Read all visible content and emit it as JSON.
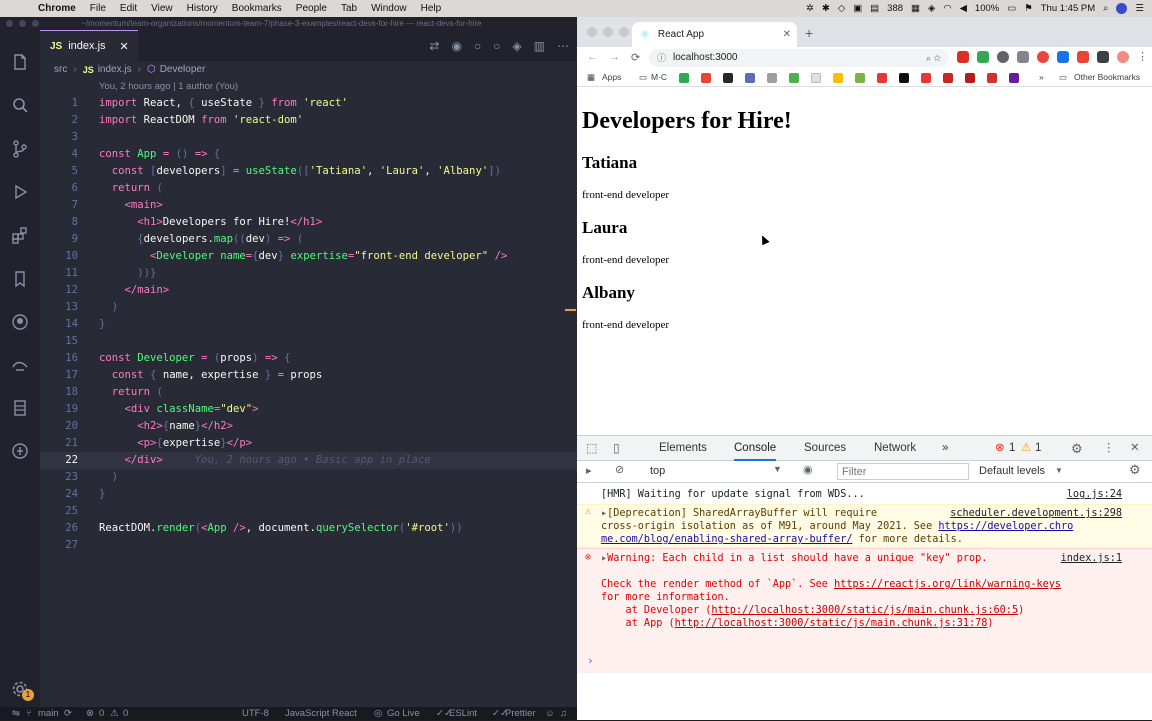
{
  "menubar": {
    "app": "Chrome",
    "items": [
      "File",
      "Edit",
      "View",
      "History",
      "Bookmarks",
      "People",
      "Tab",
      "Window",
      "Help"
    ],
    "notification_count": "388",
    "battery": "100%",
    "clock": "Thu 1:45 PM"
  },
  "vscode": {
    "title_path": "~/momentum/team-organizations/momentum-team-7/phase-3-examples/react-devs-for-hire — react-devs-for-hire",
    "tab": {
      "badge": "JS",
      "label": "index.js"
    },
    "breadcrumb": {
      "folder": "src",
      "badge": "JS",
      "file": "index.js",
      "symbol": "Developer"
    },
    "blame": "You, 2 hours ago | 1 author (You)",
    "ghost_blame": "You, 2 hours ago • Basic app in place",
    "line_numbers": [
      "1",
      "2",
      "3",
      "4",
      "5",
      "6",
      "7",
      "8",
      "9",
      "10",
      "11",
      "12",
      "13",
      "14",
      "15",
      "16",
      "17",
      "18",
      "19",
      "20",
      "21",
      "22",
      "23",
      "24",
      "25",
      "26",
      "27"
    ],
    "status": {
      "branch": "main",
      "errors": "0",
      "warnings": "0",
      "encoding": "UTF-8",
      "language": "JavaScript React",
      "golive": "Go Live",
      "eslint": "ESLint",
      "prettier": "Prettier"
    },
    "settings_badge": "1"
  },
  "chrome": {
    "tab_title": "React App",
    "url": "localhost:3000",
    "bookmarks": {
      "apps": "Apps",
      "mc": "M·C",
      "other": "Other Bookmarks"
    },
    "page": {
      "heading": "Developers for Hire!",
      "developers": [
        {
          "name": "Tatiana",
          "expertise": "front-end developer"
        },
        {
          "name": "Laura",
          "expertise": "front-end developer"
        },
        {
          "name": "Albany",
          "expertise": "front-end developer"
        }
      ]
    }
  },
  "devtools": {
    "tabs": [
      "Elements",
      "Console",
      "Sources",
      "Network"
    ],
    "active_tab": "Console",
    "error_count": "1",
    "warning_count": "1",
    "context": "top",
    "filter_placeholder": "Filter",
    "levels": "Default levels",
    "messages": {
      "hmr": "[HMR] Waiting for update signal from WDS...",
      "hmr_src": "log.js:24",
      "warn_src": "scheduler.development.js:298",
      "warn_l1": "[Deprecation] SharedArrayBuffer will require",
      "warn_l2a": "cross-origin isolation as of M91, around May 2021. See ",
      "warn_l2b": "https://developer.chro",
      "warn_l3a": "me.com/blog/enabling-shared-array-buffer/",
      "warn_l3b": " for more details.",
      "err_src": "index.js:1",
      "err_l1": "Warning: Each child in a list should have a unique \"key\" prop.",
      "err_l2a": "Check the render method of `App`. See ",
      "err_l2b": "https://reactjs.org/link/warning-keys",
      "err_l3": "for more information.",
      "err_l4a": "    at Developer (",
      "err_l4b": "http://localhost:3000/static/js/main.chunk.js:60:5",
      "err_l4c": ")",
      "err_l5a": "    at App (",
      "err_l5b": "http://localhost:3000/static/js/main.chunk.js:31:78",
      "err_l5c": ")"
    }
  }
}
